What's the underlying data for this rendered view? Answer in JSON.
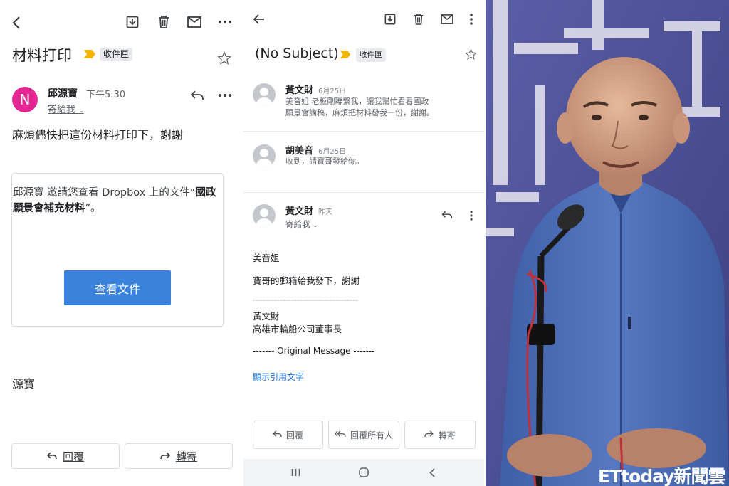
{
  "left": {
    "subject": "材料打印",
    "label": "收件匣",
    "sender_initial": "N",
    "sender": "邱源寶",
    "time": "下午5:30",
    "to": "寄給我",
    "body": "麻煩儘快把這份材料打印下，謝謝",
    "card_text_prefix": "邱源寶 邀請您查看 Dropbox 上的文件“",
    "card_doc_name": "國政願景會補充材料",
    "card_text_suffix": "”。",
    "view_button": "查看文件",
    "signature": "源寶",
    "reply_button": "回覆",
    "forward_button": "轉寄"
  },
  "middle": {
    "subject": "(No Subject)",
    "label": "收件匣",
    "messages": [
      {
        "name": "黃文財",
        "date": "6月25日",
        "snippet_line1": "美音姐 老板剛聯繫我，讓我幫忙看看國政",
        "snippet_line2": "願景會講稿，麻煩把材料發我一份，謝謝。"
      },
      {
        "name": "胡美音",
        "date": "6月25日",
        "snippet_line1": "收到，請寶哥發給你。"
      }
    ],
    "expanded": {
      "name": "黃文財",
      "date": "昨天",
      "to": "寄給我",
      "greeting": "美音姐",
      "body": "寶哥的郵箱給我發下，謝謝",
      "dashes": "--------------------------------------------------------",
      "sig_name": "黃文財",
      "sig_title": "高雄市輪船公司董事長",
      "original": "------- Original Message -------",
      "show_quoted": "顯示引用文字"
    },
    "reply_button": "回覆",
    "reply_all_button": "回覆所有人",
    "forward_button": "轉寄"
  },
  "right": {
    "watermark": "ETtoday新聞雲"
  },
  "colors": {
    "avatar_pink": "#e52592",
    "label_yellow": "#f4b400",
    "button_blue": "#3b82dc",
    "link_blue": "#1a73e8"
  }
}
